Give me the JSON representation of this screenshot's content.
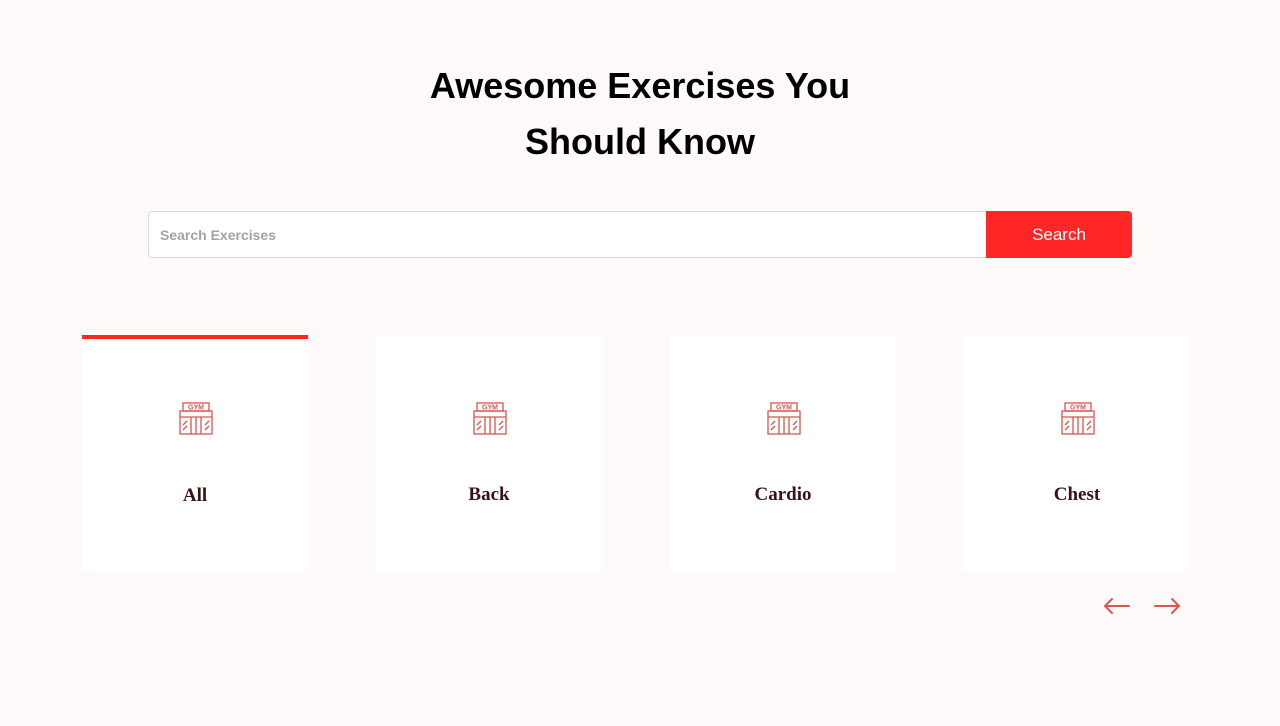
{
  "hero": {
    "title_line_1": "Awesome Exercises You",
    "title_line_2": "Should Know"
  },
  "search": {
    "placeholder": "Search Exercises",
    "value": "",
    "button_label": "Search"
  },
  "categories": [
    {
      "label": "All",
      "icon": "gym-icon",
      "active": true
    },
    {
      "label": "Back",
      "icon": "gym-icon",
      "active": false
    },
    {
      "label": "Cardio",
      "icon": "gym-icon",
      "active": false
    },
    {
      "label": "Chest",
      "icon": "gym-icon",
      "active": false
    }
  ],
  "navigation": {
    "prev_icon": "arrow-left-icon",
    "next_icon": "arrow-right-icon"
  },
  "colors": {
    "accent": "#ff2625",
    "background": "#fefafa",
    "card": "#ffffff",
    "card_label": "#3a1212"
  }
}
